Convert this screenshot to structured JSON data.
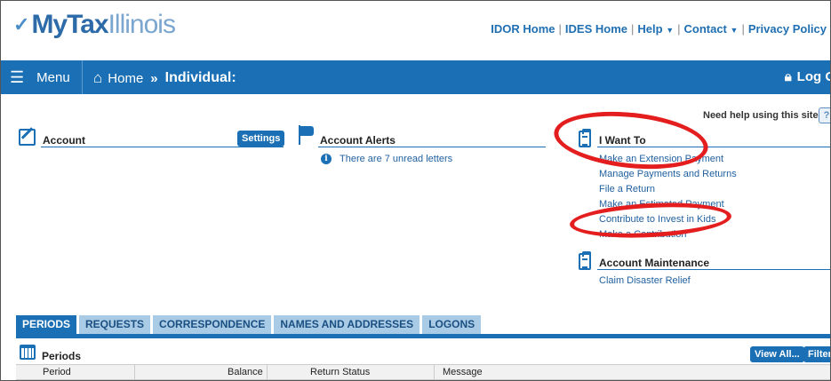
{
  "logo": {
    "my": "MyTax",
    "illinois": "Illinois"
  },
  "header_links": [
    "IDOR Home",
    "IDES Home",
    "Help",
    "Contact",
    "Privacy Policy"
  ],
  "nav": {
    "menu_label": "Menu",
    "home_label": "Home",
    "current_page": "Individual:",
    "logout_label": "Log O"
  },
  "help_text": "Need help using this site?",
  "account": {
    "title": "Account",
    "settings_label": "Settings"
  },
  "alerts": {
    "title": "Account Alerts",
    "message": "There are 7 unread letters"
  },
  "i_want_to": {
    "title": "I Want To",
    "links": [
      "Make an Extension Payment",
      "Manage Payments and Returns",
      "File a Return",
      "Make an Estimated Payment",
      "Contribute to Invest in Kids",
      "Make a Contribution"
    ]
  },
  "maintenance": {
    "title": "Account Maintenance",
    "links": [
      "Claim Disaster Relief"
    ]
  },
  "tabs": [
    "PERIODS",
    "REQUESTS",
    "CORRESPONDENCE",
    "NAMES AND ADDRESSES",
    "LOGONS"
  ],
  "periods": {
    "title": "Periods",
    "view_all_label": "View All...",
    "filter_label": "Filter",
    "columns": [
      "Period",
      "Balance",
      "Return Status",
      "Message"
    ]
  },
  "colors": {
    "brand_blue": "#1a6fb5",
    "annotation_red": "#e41e1e"
  }
}
